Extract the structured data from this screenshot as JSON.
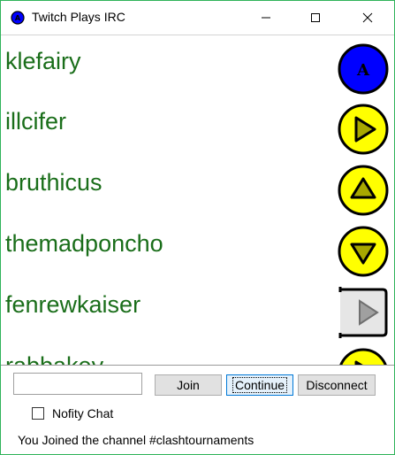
{
  "window": {
    "title": "Twitch Plays IRC",
    "border_color": "#2fb35a"
  },
  "feed": [
    {
      "user": "klefairy",
      "command": "A",
      "icon": "a-button-icon",
      "color": "#0000ff"
    },
    {
      "user": "illcifer",
      "command": "right",
      "icon": "right-arrow-icon",
      "color": "#ffff00"
    },
    {
      "user": "bruthicus",
      "command": "up",
      "icon": "up-arrow-icon",
      "color": "#ffff00"
    },
    {
      "user": "themadponcho",
      "command": "down",
      "icon": "down-arrow-icon",
      "color": "#ffff00"
    },
    {
      "user": "fenrewkaiser",
      "command": "right-trigger",
      "icon": "right-trigger-icon",
      "color": "#e6e6e6"
    },
    {
      "user": "rabbakey",
      "command": "right",
      "icon": "right-arrow-icon",
      "color": "#ffff00"
    }
  ],
  "controls": {
    "channel_input_value": "",
    "join_label": "Join",
    "continue_label": "Continue",
    "disconnect_label": "Disconnect",
    "notify_label": "Nofity Chat",
    "notify_checked": false,
    "status": "You Joined the channel #clashtournaments"
  },
  "colors": {
    "username": "#1a6e1a",
    "focus_button": "#0078d7"
  }
}
